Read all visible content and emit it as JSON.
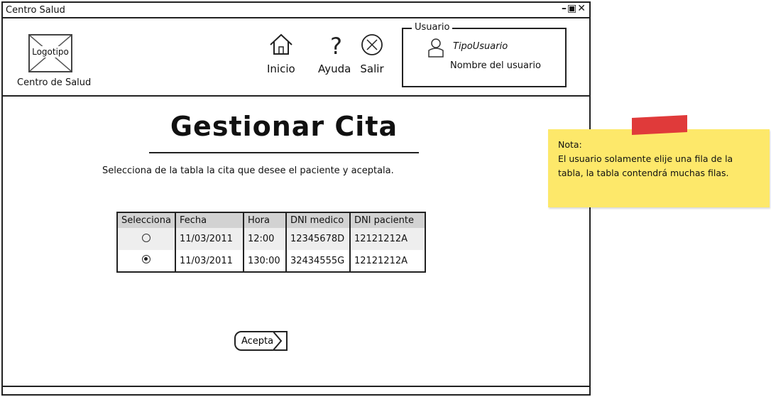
{
  "window": {
    "title": "Centro Salud",
    "controls": "–▣✕"
  },
  "header": {
    "logo_text": "Logotipo",
    "center_name": "Centro de Salud",
    "nav": {
      "home": "Inicio",
      "help": "Ayuda",
      "exit": "Salir"
    }
  },
  "user": {
    "legend": "Usuario",
    "type": "TipoUsuario",
    "name": "Nombre del usuario"
  },
  "main": {
    "title": "Gestionar Cita",
    "instruction": "Selecciona de la tabla la cita que desee el paciente y aceptala.",
    "accept_label": "Acepta"
  },
  "table": {
    "headers": [
      "Selecciona",
      "Fecha",
      "Hora",
      "DNI medico",
      "DNI paciente"
    ],
    "rows": [
      {
        "selected": false,
        "fecha": "11/03/2011",
        "hora": "12:00",
        "dni_medico": "12345678D",
        "dni_paciente": "12121212A"
      },
      {
        "selected": true,
        "fecha": "11/03/2011",
        "hora": "130:00",
        "dni_medico": "32434555G",
        "dni_paciente": "12121212A"
      }
    ]
  },
  "note": {
    "heading": "Nota:",
    "body": "El usuario solamente elije una fila de la tabla, la tabla contendrá muchas filas."
  },
  "colors": {
    "note_bg": "#fde86a",
    "note_tape": "#e03a3a",
    "table_header": "#d2d2d2"
  }
}
